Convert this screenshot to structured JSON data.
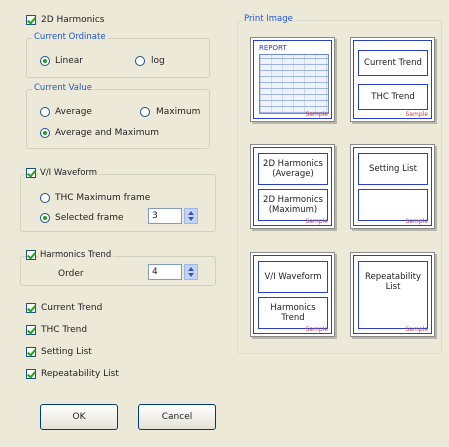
{
  "harmonics_2d": {
    "label": "2D Harmonics",
    "current_ordinate": {
      "label": "Current Ordinate",
      "options": [
        "Linear",
        "log"
      ],
      "selected": "Linear"
    },
    "current_value": {
      "label": "Current Value",
      "options": [
        "Average",
        "Maximum",
        "Average and Maximum"
      ],
      "selected": "Average and Maximum"
    }
  },
  "vi_waveform": {
    "label": "V/I Waveform",
    "options": [
      "THC Maximum frame",
      "Selected frame"
    ],
    "selected": "Selected frame",
    "frame_value": "3"
  },
  "harmonics_trend": {
    "label": "Harmonics Trend",
    "order_label": "Order",
    "order_value": "4"
  },
  "checks": {
    "current_trend": "Current Trend",
    "thc_trend": "THC Trend",
    "setting_list": "Setting List",
    "repeatability_list": "Repeatability List"
  },
  "buttons": {
    "ok": "OK",
    "cancel": "Cancel"
  },
  "print_image": {
    "label": "Print Image",
    "report_title": "REPORT",
    "sample": "Sample",
    "page2": [
      "Current Trend",
      "THC Trend"
    ],
    "page3": [
      "2D Harmonics\n(Average)",
      "2D Harmonics\n(Maximum)"
    ],
    "page4": [
      "Setting List",
      ""
    ],
    "page5": [
      "V/I Waveform",
      "Harmonics\nTrend"
    ],
    "page6": [
      "Repeatability\nList"
    ]
  },
  "colors": {
    "check": "#21a121",
    "group_label": "#2256c9",
    "slot_border": "#2a3fc9"
  }
}
